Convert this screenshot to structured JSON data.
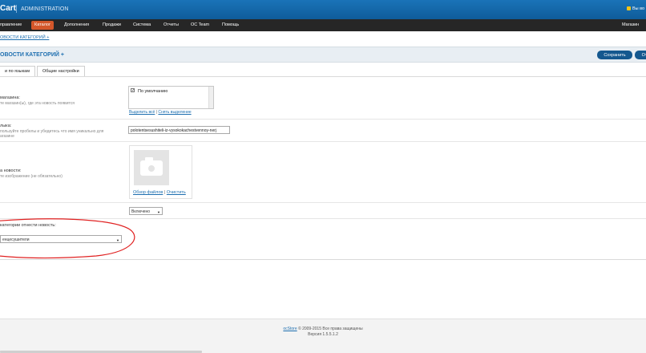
{
  "header": {
    "brand": "Cart",
    "brand_sub": "ADMINISTRATION",
    "logged_in": "Вы во"
  },
  "menu": [
    {
      "label": "правление"
    },
    {
      "label": "Каталог"
    },
    {
      "label": "Дополнения"
    },
    {
      "label": "Продажи"
    },
    {
      "label": "Система"
    },
    {
      "label": "Отчеты"
    },
    {
      "label": "OC Team"
    },
    {
      "label": "Помощь"
    },
    {
      "label": "Магазин"
    }
  ],
  "breadcrumb": "ОВОСТИ КАТЕГОРИЙ +",
  "title": "ОВОСТИ КАТЕГОРИЙ +",
  "buttons": {
    "save": "Сохранить",
    "cancel": "От"
  },
  "tabs": [
    {
      "label": "и по языкам"
    },
    {
      "label": "Общие настройки"
    }
  ],
  "form": {
    "store": {
      "label": "магазина:",
      "help": "те магазин(ы), где эта новость появится",
      "option": "По умолчанию",
      "select_all": "Выделить всё",
      "link_sep": " | ",
      "deselect": "Снять выделение"
    },
    "seo": {
      "label": "лыка:",
      "help1": "пользуйте пробелы и убедитесь что имя уникально для",
      "help2": "агазине",
      "value": "polotentsesushiteli-iz-vysokokachestvennoy-nerj"
    },
    "image": {
      "label": "а новости:",
      "help": "те изображение (не обязательно)",
      "browse": "Обзор файлов",
      "link_sep": " | ",
      "clear": "Очистить"
    },
    "status": {
      "value": "Включено"
    },
    "category": {
      "label": "категории отнести новость:",
      "value": "енцесушители"
    }
  },
  "footer": {
    "copyright_link": "ocStore",
    "copyright_text": " © 2009-2015 Все права защищены",
    "version": "Версия 1.5.5.1.2"
  },
  "colors": {
    "header": "#1a73b8",
    "menubar": "#262626",
    "menu_active": "#d4572a",
    "button": "#14588f",
    "annotation": "#e02020"
  }
}
